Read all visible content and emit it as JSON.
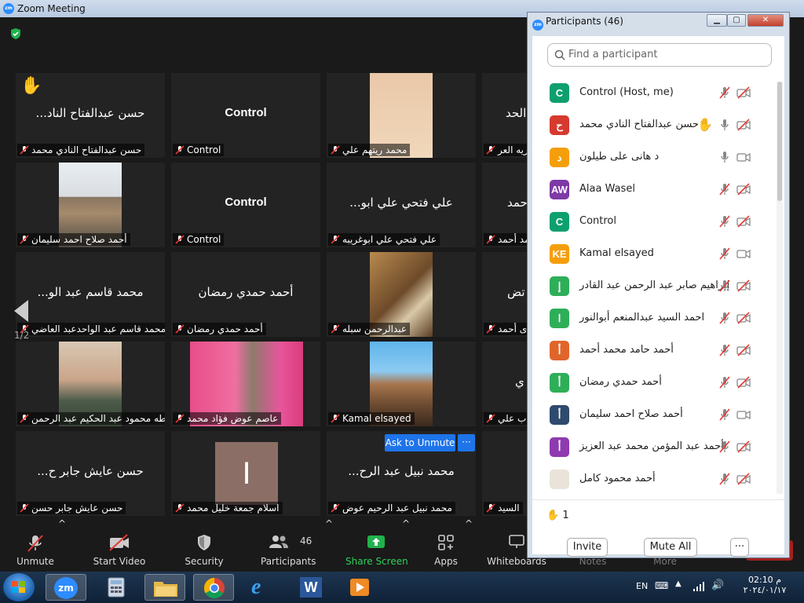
{
  "window": {
    "title": "Zoom Meeting",
    "icon": "zm"
  },
  "gallery": {
    "page": "1/2",
    "ask_to_unmute": "Ask to Unmute",
    "more": "···",
    "tiles": [
      {
        "name": "...حسن عبدالفتاح الناد",
        "label": "حسن عبدالفتاح النادي محمد",
        "hand": "✋"
      },
      {
        "name": "Control",
        "label": "Control"
      },
      {
        "label": "محمد ريتهم علي"
      },
      {
        "name": "الحد",
        "label": "ريه العر"
      },
      {
        "label": "أحمد صلاح احمد سليمان"
      },
      {
        "name": "Control",
        "label": "Control"
      },
      {
        "name": "...علي فتحي علي ابو",
        "label": "علي فتحي علي ابوغريبه"
      },
      {
        "name": "حمد",
        "label": "حمد أحمد"
      },
      {
        "name": "...محمد قاسم عبد الو",
        "label": "محمد قاسم عبد الواحدعبد العاضي"
      },
      {
        "name": "أحمد حمدي رمضان",
        "label": "أحمد حمدي رمضان"
      },
      {
        "label": "عبدالرحمن سبله"
      },
      {
        "name": "تض",
        "label": "ى أحمد"
      },
      {
        "label": "طه محمود عبد الحكيم عبد الرحمن"
      },
      {
        "label": "عاصم عوض فؤاد محمد"
      },
      {
        "label": "Kamal elsayed"
      },
      {
        "name": "ي",
        "label": "ب علي"
      },
      {
        "name": "...حسن عايش جابر ح",
        "label": "حسن عايش جابر حسن"
      },
      {
        "initial": "I",
        "label": "اسلام جمعة خليل محمد"
      },
      {
        "name": "...محمد نبيل عبد الرح",
        "label": "محمد نبيل عبد الرحيم عوض"
      },
      {
        "label": "السيد"
      }
    ]
  },
  "toolbar": {
    "unmute": "Unmute",
    "start_video": "Start Video",
    "security": "Security",
    "participants": "Participants",
    "participants_count": "46",
    "share_screen": "Share Screen",
    "apps": "Apps",
    "whiteboards": "Whiteboards",
    "notes": "Notes",
    "more": "More",
    "caret": "^"
  },
  "participants_panel": {
    "title": "Participants (46)",
    "search_placeholder": "Find a participant",
    "raised_hands": "1",
    "hand_icon": "✋",
    "invite": "Invite",
    "mute_all": "Mute All",
    "more": "···",
    "participants": [
      {
        "initial": "C",
        "color": "#0e9f6e",
        "name": "Control (Host, me)",
        "mic": "muted",
        "video": "off"
      },
      {
        "initial": "ح",
        "color": "#d63a2f",
        "name": "حسن عبدالفتاح النادي محمد",
        "mic": "on",
        "video": "off",
        "hand": true
      },
      {
        "initial": "د",
        "color": "#f59e0b",
        "name": "د هانى على طيلون",
        "mic": "on",
        "video": "on"
      },
      {
        "initial": "AW",
        "color": "#7e3aa6",
        "name": "Alaa Wasel",
        "mic": "muted",
        "video": "off"
      },
      {
        "initial": "C",
        "color": "#0e9f6e",
        "name": "Control",
        "mic": "muted",
        "video": "off"
      },
      {
        "initial": "KE",
        "color": "#f59e0b",
        "name": "Kamal elsayed",
        "mic": "muted",
        "video": "on"
      },
      {
        "initial": "إ",
        "color": "#2fae59",
        "name": "إبراهيم صابر عبد الرحمن عبد القادر",
        "mic": "muted",
        "video": "off"
      },
      {
        "initial": "ا",
        "color": "#2fae59",
        "name": "احمد السيد عبدالمنعم أبوالنور",
        "mic": "muted",
        "video": "off"
      },
      {
        "initial": "أ",
        "color": "#e0652b",
        "name": "أحمد حامد محمد أحمد",
        "mic": "muted",
        "video": "off"
      },
      {
        "initial": "أ",
        "color": "#2fae59",
        "name": "أحمد حمدي رمضان",
        "mic": "muted",
        "video": "off"
      },
      {
        "initial": "أ",
        "color": "#2e4a6d",
        "name": "أحمد صلاح احمد سليمان",
        "mic": "muted",
        "video": "on"
      },
      {
        "initial": "أ",
        "color": "#8e3ab0",
        "name": "أحمد عبد المؤمن محمد عبد العزيز",
        "mic": "muted",
        "video": "off"
      },
      {
        "initial": "",
        "color": "#e9e3da",
        "name": "أحمد محمود كامل",
        "mic": "muted",
        "video": "off"
      }
    ]
  },
  "taskbar": {
    "zoom_label": "zm",
    "lang": "EN",
    "time": "02:10 م",
    "date": "٢٠٢٤/٠١/١٧"
  }
}
